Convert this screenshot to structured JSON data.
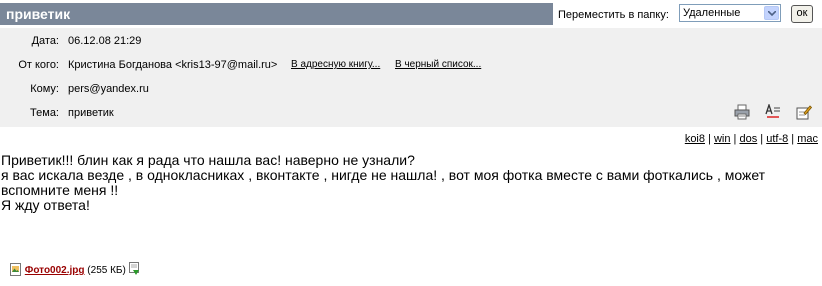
{
  "message": {
    "subject_title": "приветик",
    "move_to_folder_label": "Переместить в папку:",
    "folder_selected": "Удаленные",
    "ok_label": "ок"
  },
  "header": {
    "date_label": "Дата:",
    "date_value": "06.12.08 21:29",
    "from_label": "От кого:",
    "from_value": "Кристина Богданова <kris13-97@mail.ru>",
    "add_to_address_book": "В адресную книгу...",
    "add_to_blacklist": "В черный список...",
    "to_label": "Кому:",
    "to_value": "pers@yandex.ru",
    "subject_label": "Тема:",
    "subject_value": "приветик"
  },
  "toolbar_icons": [
    "printer-icon",
    "spellcheck-icon",
    "edit-icon"
  ],
  "encodings": [
    "koi8",
    "win",
    "dos",
    "utf-8",
    "mac"
  ],
  "body_lines": [
    "Приветик!!! блин как я рада что нашла вас! наверно не узнали?",
    "я вас искала везде , в однокласниках , вконтакте , нигде не нашла! , вот моя фотка вместе с вами фоткались , может",
    "вспомните меня !!",
    "Я жду ответа!"
  ],
  "attachment": {
    "name": "Фото002.jpg",
    "size": "(255 КБ)"
  }
}
